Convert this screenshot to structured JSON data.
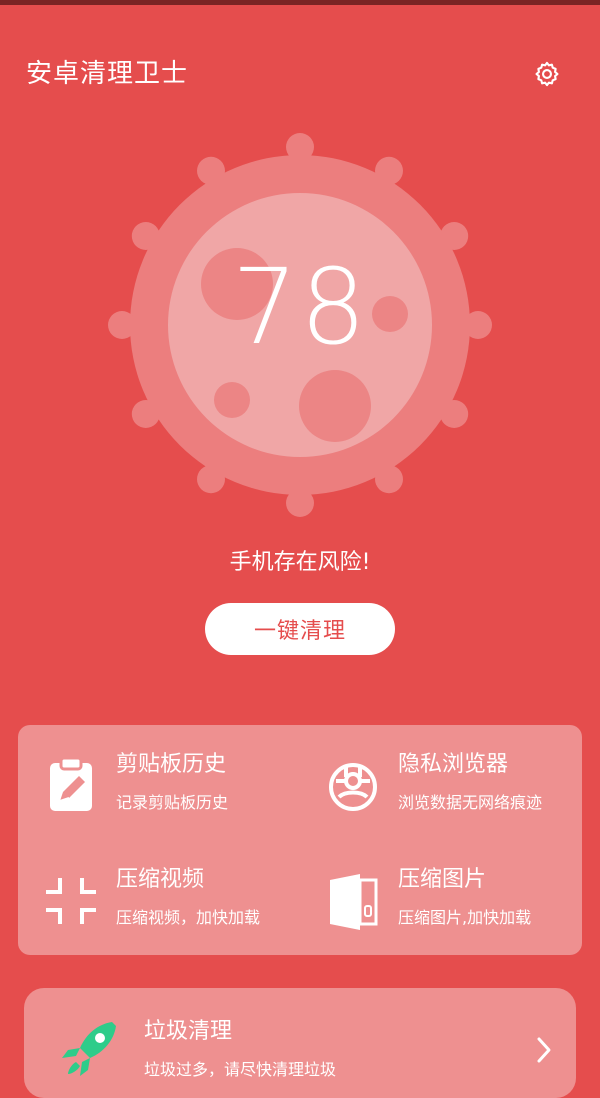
{
  "app": {
    "title": "安卓清理卫士"
  },
  "header": {
    "settings_icon": "gear-icon"
  },
  "gauge": {
    "score": "78"
  },
  "status": {
    "risk_text": "手机存在风险!"
  },
  "actions": {
    "clean_button": "一键清理"
  },
  "tools": [
    {
      "title": "剪贴板历史",
      "subtitle": "记录剪贴板历史",
      "icon": "clipboard-edit-icon"
    },
    {
      "title": "隐私浏览器",
      "subtitle": "浏览数据无网络痕迹",
      "icon": "privacy-browser-icon"
    },
    {
      "title": "压缩视频",
      "subtitle": "压缩视频，加快加载",
      "icon": "compress-arrows-icon"
    },
    {
      "title": "压缩图片",
      "subtitle": "压缩图片,加快加载",
      "icon": "zip-file-icon"
    }
  ],
  "junk": {
    "title": "垃圾清理",
    "subtitle": "垃圾过多，请尽快清理垃圾",
    "icon": "rocket-icon"
  },
  "colors": {
    "background": "#e54d4d",
    "card": "#ee9090",
    "status_bar": "#7a2424",
    "rocket_green": "#2ecc8a"
  }
}
